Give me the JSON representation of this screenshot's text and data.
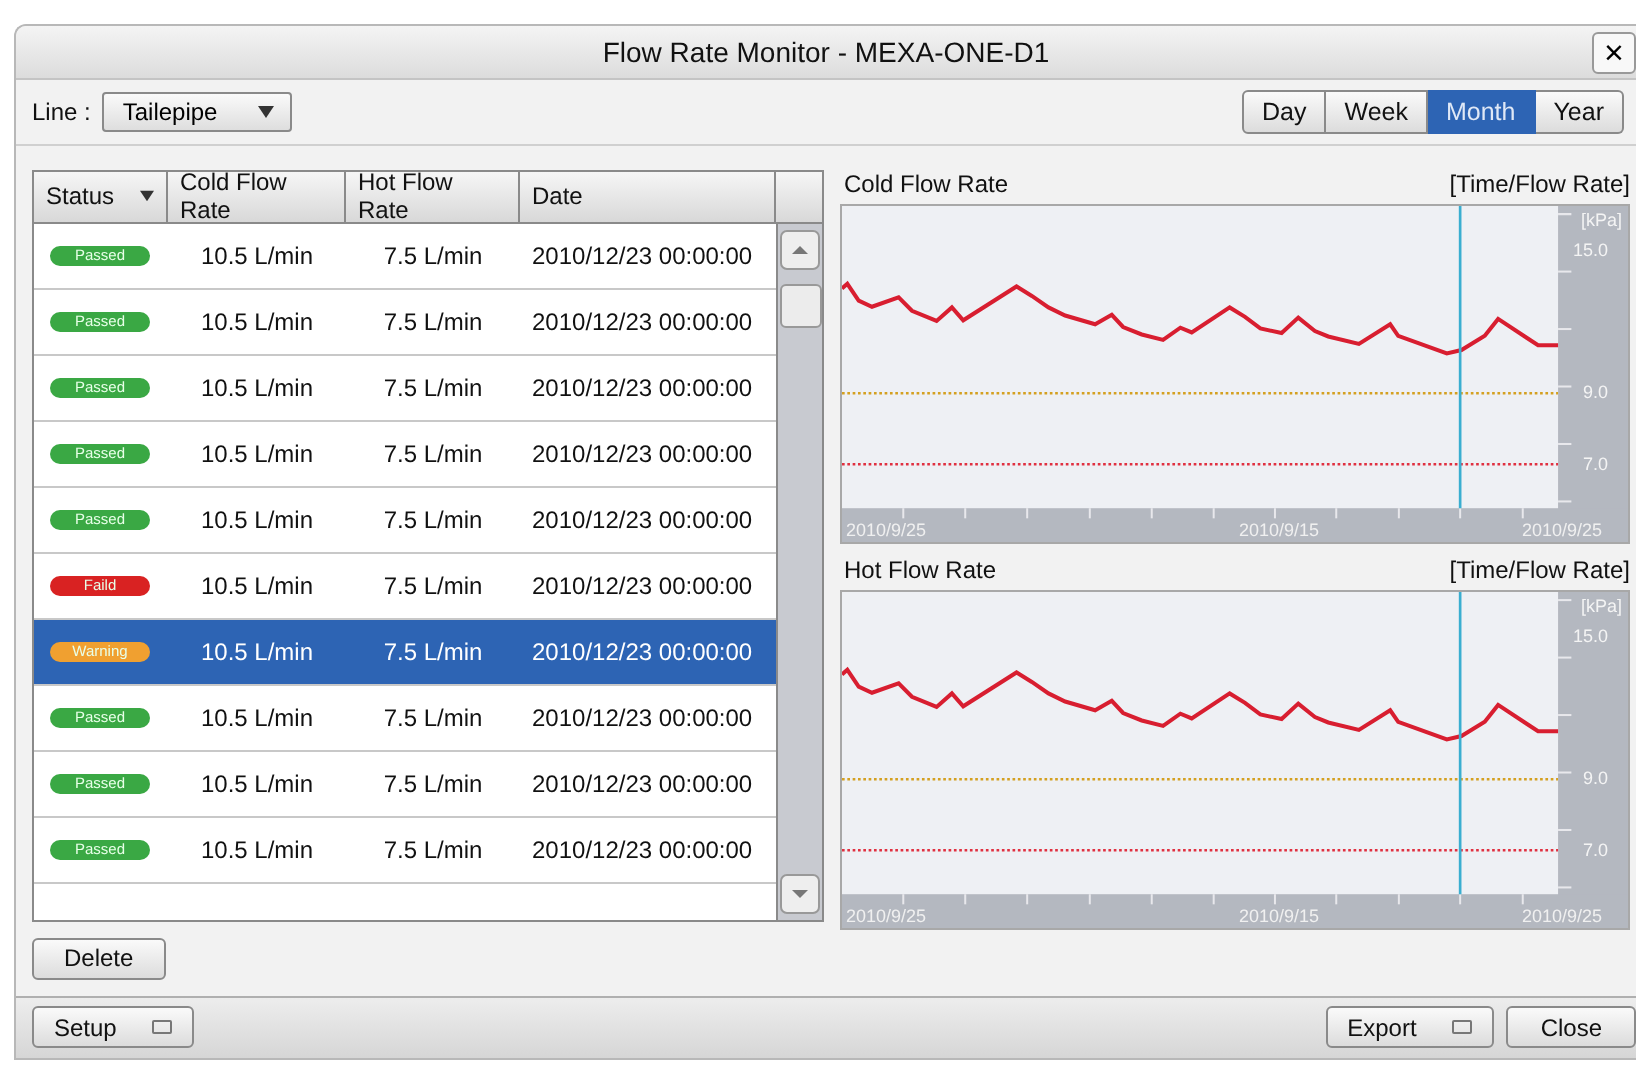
{
  "window": {
    "title": "Flow Rate Monitor - MEXA-ONE-D1",
    "close_icon": "×"
  },
  "line_selector": {
    "label": "Line :",
    "value": "Tailepipe"
  },
  "period_tabs": [
    {
      "label": "Day",
      "selected": false
    },
    {
      "label": "Week",
      "selected": false
    },
    {
      "label": "Month",
      "selected": true
    },
    {
      "label": "Year",
      "selected": false
    }
  ],
  "table": {
    "columns": [
      "Status",
      "Cold Flow Rate",
      "Hot Flow Rate",
      "Date"
    ],
    "rows": [
      {
        "status": "Passed",
        "color": "#3aa844",
        "cold": "10.5 L/min",
        "hot": "7.5 L/min",
        "date": "2010/12/23 00:00:00",
        "selected": false
      },
      {
        "status": "Passed",
        "color": "#3aa844",
        "cold": "10.5 L/min",
        "hot": "7.5 L/min",
        "date": "2010/12/23 00:00:00",
        "selected": false
      },
      {
        "status": "Passed",
        "color": "#3aa844",
        "cold": "10.5 L/min",
        "hot": "7.5 L/min",
        "date": "2010/12/23 00:00:00",
        "selected": false
      },
      {
        "status": "Passed",
        "color": "#3aa844",
        "cold": "10.5 L/min",
        "hot": "7.5 L/min",
        "date": "2010/12/23 00:00:00",
        "selected": false
      },
      {
        "status": "Passed",
        "color": "#3aa844",
        "cold": "10.5 L/min",
        "hot": "7.5 L/min",
        "date": "2010/12/23 00:00:00",
        "selected": false
      },
      {
        "status": "Faild",
        "color": "#d92222",
        "cold": "10.5 L/min",
        "hot": "7.5 L/min",
        "date": "2010/12/23 00:00:00",
        "selected": false
      },
      {
        "status": "Warning",
        "color": "#f0a030",
        "cold": "10.5 L/min",
        "hot": "7.5 L/min",
        "date": "2010/12/23 00:00:00",
        "selected": true
      },
      {
        "status": "Passed",
        "color": "#3aa844",
        "cold": "10.5 L/min",
        "hot": "7.5 L/min",
        "date": "2010/12/23 00:00:00",
        "selected": false
      },
      {
        "status": "Passed",
        "color": "#3aa844",
        "cold": "10.5 L/min",
        "hot": "7.5 L/min",
        "date": "2010/12/23 00:00:00",
        "selected": false
      },
      {
        "status": "Passed",
        "color": "#3aa844",
        "cold": "10.5 L/min",
        "hot": "7.5 L/min",
        "date": "2010/12/23 00:00:00",
        "selected": false
      }
    ]
  },
  "charts": [
    {
      "title": "Cold Flow Rate",
      "mode": "[Time/Flow Rate]",
      "unit": "[kPa]",
      "y_labels": [
        "15.0",
        "9.0",
        "7.0"
      ],
      "x_labels": [
        "2010/9/25",
        "2010/9/15",
        "2010/9/25"
      ]
    },
    {
      "title": "Hot Flow Rate",
      "mode": "[Time/Flow Rate]",
      "unit": "[kPa]",
      "y_labels": [
        "15.0",
        "9.0",
        "7.0"
      ],
      "x_labels": [
        "2010/9/25",
        "2010/9/15",
        "2010/9/25"
      ]
    }
  ],
  "buttons": {
    "delete": "Delete",
    "setup": "Setup",
    "export": "Export",
    "close": "Close"
  }
}
